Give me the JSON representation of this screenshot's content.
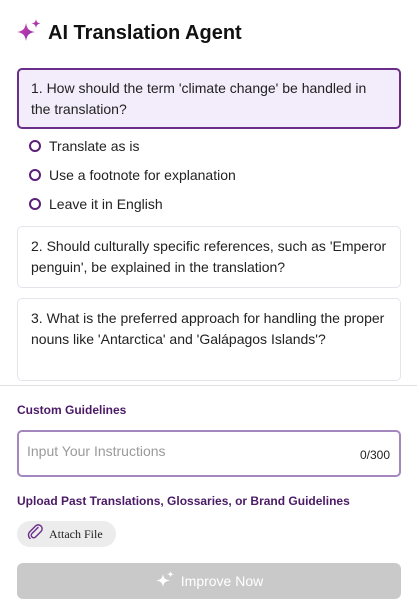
{
  "app": {
    "title": "AI Translation Agent",
    "icon": "sparkle-icon",
    "accent_color": "#6a2d8a"
  },
  "questions": [
    {
      "text": "1. How should the term 'climate change' be handled in the translation?",
      "active": true,
      "options": [
        "Translate as is",
        "Use a footnote for explanation",
        "Leave it in English"
      ]
    },
    {
      "text": "2. Should culturally specific references, such as 'Emperor penguin', be explained in the translation?",
      "active": false
    },
    {
      "text": "3. What is the preferred approach for handling the proper nouns like 'Antarctica' and 'Galápagos Islands'?",
      "active": false
    }
  ],
  "custom_guidelines": {
    "label": "Custom Guidelines",
    "placeholder": "Input Your Instructions",
    "counter": "0/300"
  },
  "upload": {
    "label": "Upload Past Translations, Glossaries, or Brand Guidelines",
    "attach_label": "Attach File",
    "icon": "paperclip-icon"
  },
  "improve_button": {
    "label": "Improve Now",
    "icon": "sparkle-icon",
    "state": "disabled"
  }
}
